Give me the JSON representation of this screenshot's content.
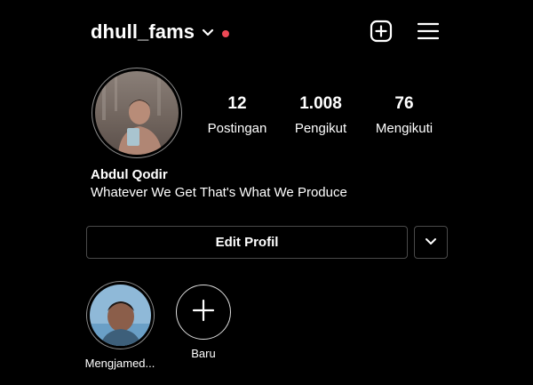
{
  "header": {
    "username": "dhull_fams",
    "icons": [
      "chevron-down-icon",
      "notification-dot",
      "new-post-icon",
      "menu-icon"
    ],
    "accent_dot_color": "#ed4956"
  },
  "profile": {
    "name": "Abdul Qodir",
    "bio": "Whatever We Get That's What We Produce",
    "stats": [
      {
        "value": "12",
        "label": "Postingan"
      },
      {
        "value": "1.008",
        "label": "Pengikut"
      },
      {
        "value": "76",
        "label": "Mengikuti"
      }
    ]
  },
  "actions": {
    "edit_label": "Edit Profil"
  },
  "highlights": [
    {
      "label": "Mengjamed..."
    },
    {
      "label": "Baru"
    }
  ]
}
